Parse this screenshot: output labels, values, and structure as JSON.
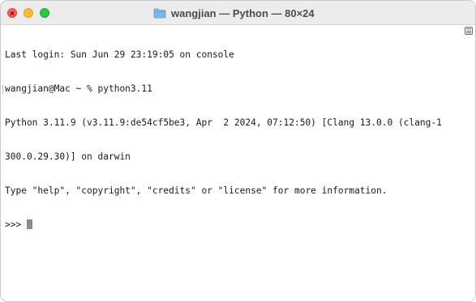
{
  "window": {
    "title": "wangjian — Python — 80×24",
    "folder_icon": "folder-icon",
    "colors": {
      "close": "#ff5f57",
      "minimize": "#febc2e",
      "zoom": "#28c840",
      "folder": "#7fb6e8"
    }
  },
  "terminal": {
    "lines": [
      "Last login: Sun Jun 29 23:19:05 on console",
      "wangjian@Mac ~ % python3.11",
      "Python 3.11.9 (v3.11.9:de54cf5be3, Apr  2 2024, 07:12:50) [Clang 13.0.0 (clang-1",
      "300.0.29.30)] on darwin",
      "Type \"help\", \"copyright\", \"credits\" or \"license\" for more information."
    ],
    "prompt": ">>> "
  }
}
